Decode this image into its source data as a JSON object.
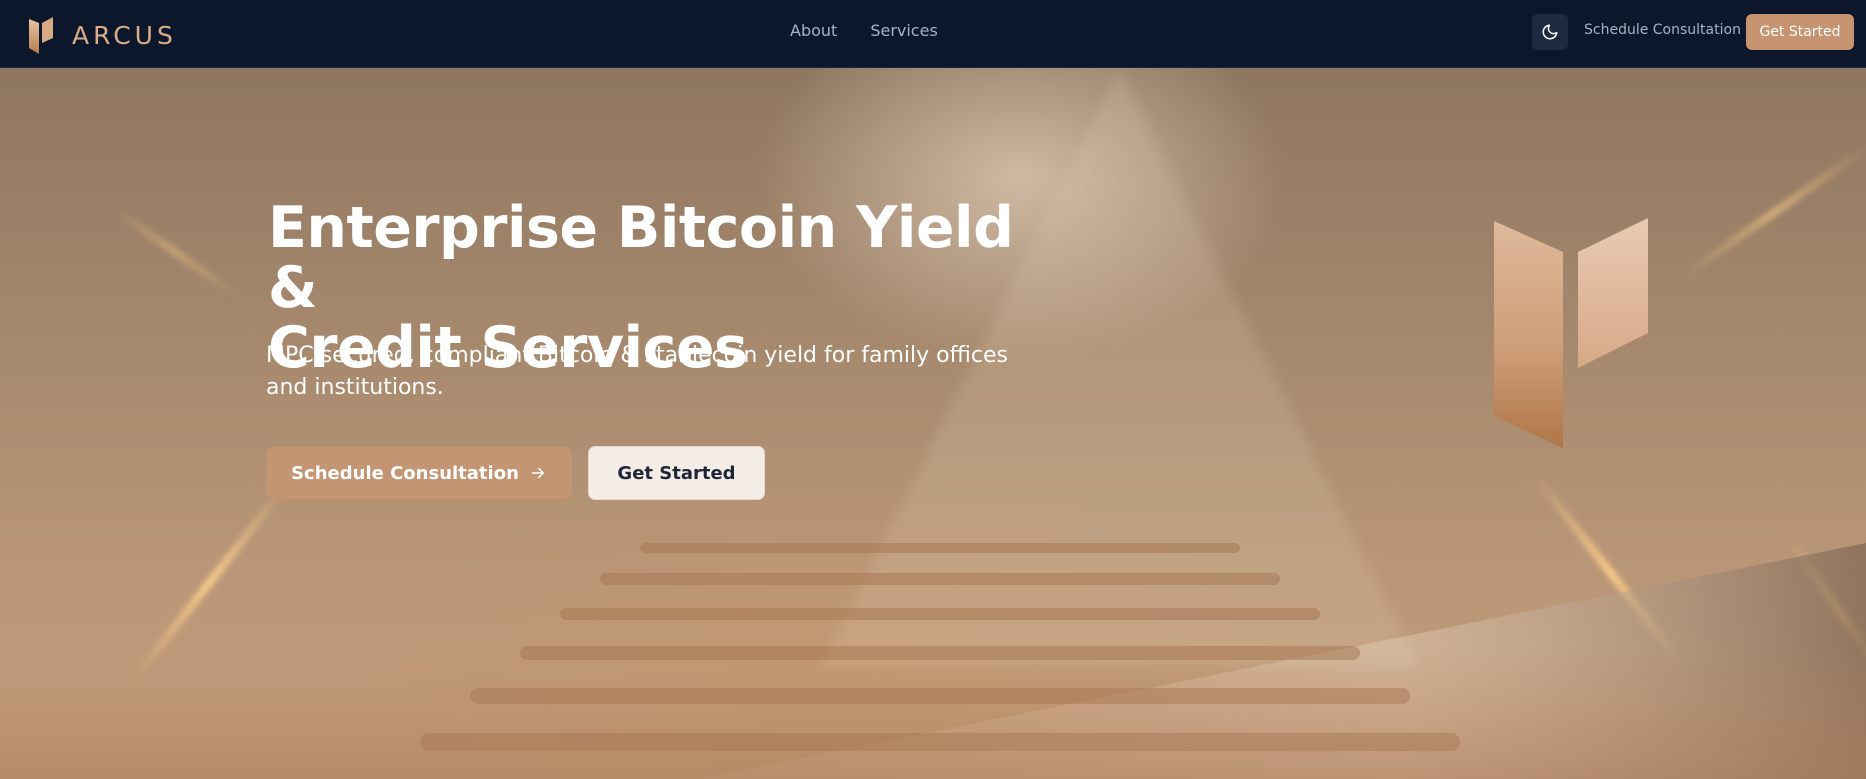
{
  "brand": {
    "name": "ARCUS",
    "logo_icon": "arcus-logo-icon"
  },
  "nav": {
    "links": [
      {
        "label": "About"
      },
      {
        "label": "Services"
      }
    ],
    "theme_toggle_icon": "moon-icon",
    "consult_label": "Schedule Consultation",
    "start_label": "Get Started"
  },
  "hero": {
    "title_line1": "Enterprise Bitcoin Yield &",
    "title_line2": "Credit Services",
    "subtitle_line1": "MPC secured, compliant Bitcoin & stablecoin yield for family offices",
    "subtitle_line2": "and institutions.",
    "primary_cta": "Schedule Consultation",
    "primary_cta_icon": "arrow-right-icon",
    "secondary_cta": "Get Started",
    "emblem_icon": "arcus-emblem-icon"
  },
  "colors": {
    "nav_bg": "#0d172b",
    "accent": "#c69470",
    "hero_text": "#ffffff",
    "secondary_btn_bg": "#f3ece7"
  }
}
